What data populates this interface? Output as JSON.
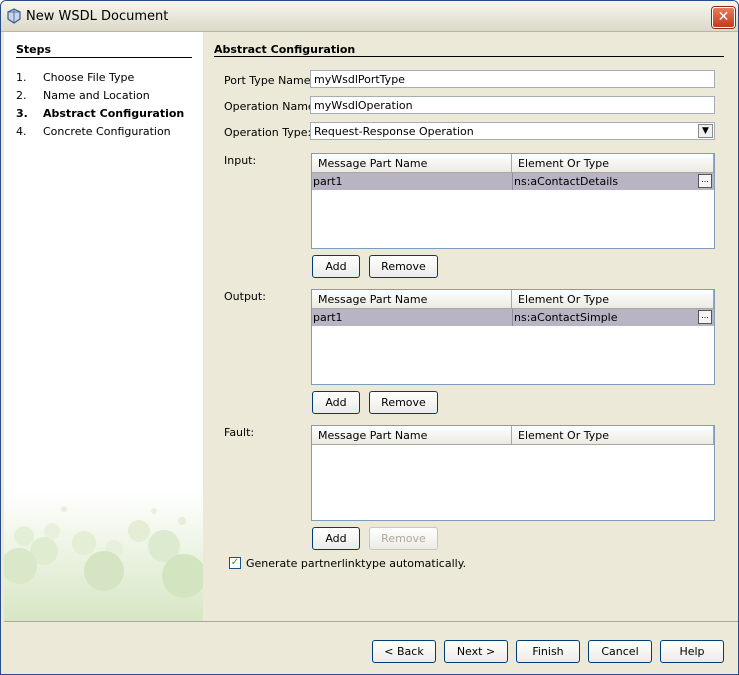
{
  "window": {
    "title": "New WSDL Document",
    "close_symbol": "✕"
  },
  "steps": {
    "title": "Steps",
    "items": [
      {
        "num": "1.",
        "label": "Choose File Type"
      },
      {
        "num": "2.",
        "label": "Name and Location"
      },
      {
        "num": "3.",
        "label": "Abstract Configuration",
        "current": true
      },
      {
        "num": "4.",
        "label": "Concrete Configuration"
      }
    ]
  },
  "main": {
    "section_title": "Abstract Configuration",
    "port_type_label": "Port Type Name:",
    "port_type_value": "myWsdlPortType",
    "operation_name_label": "Operation Name:",
    "operation_name_value": "myWsdlOperation",
    "operation_type_label": "Operation Type:",
    "operation_type_value": "Request-Response Operation",
    "input_label": "Input:",
    "output_label": "Output:",
    "fault_label": "Fault:",
    "col_part_name": "Message Part Name",
    "col_element_type": "Element Or Type",
    "input_rows": [
      {
        "part": "part1",
        "type": "ns:aContactDetails"
      }
    ],
    "output_rows": [
      {
        "part": "part1",
        "type": "ns:aContactSimple"
      }
    ],
    "add_label": "Add",
    "remove_label": "Remove",
    "ellipsis": "...",
    "generate_label": "Generate partnerlinktype automatically.",
    "generate_checked": true
  },
  "footer": {
    "back": "< Back",
    "next": "Next >",
    "finish": "Finish",
    "cancel": "Cancel",
    "help": "Help"
  }
}
